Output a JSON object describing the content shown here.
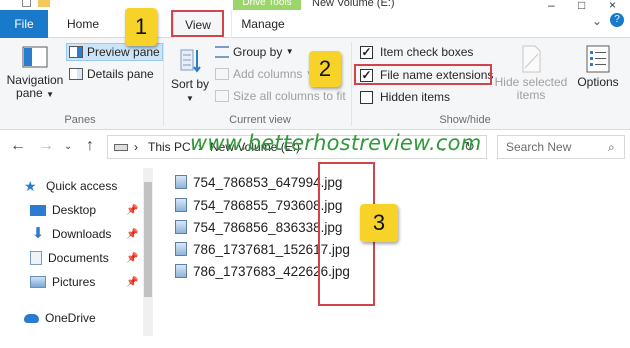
{
  "window": {
    "title": "New Volume (E:)",
    "contextual_tab_header": "Drive Tools"
  },
  "tabs": {
    "file": "File",
    "home": "Home",
    "view": "View",
    "manage": "Manage"
  },
  "ribbon": {
    "panes": {
      "label": "Panes",
      "navigation_pane": "Navigation pane",
      "preview_pane": "Preview pane",
      "details_pane": "Details pane"
    },
    "current_view": {
      "label": "Current view",
      "sort_by": "Sort by",
      "group_by": "Group by",
      "add_columns": "Add columns",
      "size_all_columns": "Size all columns to fit"
    },
    "show_hide": {
      "label": "Show/hide",
      "item_check_boxes": {
        "label": "Item check boxes",
        "checked": true
      },
      "file_name_extensions": {
        "label": "File name extensions",
        "checked": true
      },
      "hidden_items": {
        "label": "Hidden items",
        "checked": false
      },
      "hide_selected_items": "Hide selected items",
      "options": "Options"
    }
  },
  "address_bar": {
    "crumbs": [
      "This PC",
      "New Volume (E:)"
    ],
    "search_placeholder": "Search New"
  },
  "watermark": "www.betterhostreview.com",
  "navigation": [
    {
      "label": "Quick access",
      "icon": "star-icon",
      "pinned": false
    },
    {
      "label": "Desktop",
      "icon": "desktop-icon",
      "pinned": true
    },
    {
      "label": "Downloads",
      "icon": "download-icon",
      "pinned": true
    },
    {
      "label": "Documents",
      "icon": "documents-icon",
      "pinned": true
    },
    {
      "label": "Pictures",
      "icon": "pictures-icon",
      "pinned": true
    },
    {
      "label": "OneDrive",
      "icon": "cloud-icon",
      "pinned": false
    }
  ],
  "files": [
    "754_786853_647994.jpg",
    "754_786855_793608.jpg",
    "754_786856_836338.jpg",
    "786_1737681_152617.jpg",
    "786_1737683_422626.jpg"
  ],
  "callouts": [
    "1",
    "2",
    "3"
  ],
  "colors": {
    "file_tab": "#1979ca",
    "drive_tools": "#9cd66b",
    "highlight_outline": "#d2444c",
    "badge": "#f7d32a",
    "watermark": "#2f9a3a"
  }
}
